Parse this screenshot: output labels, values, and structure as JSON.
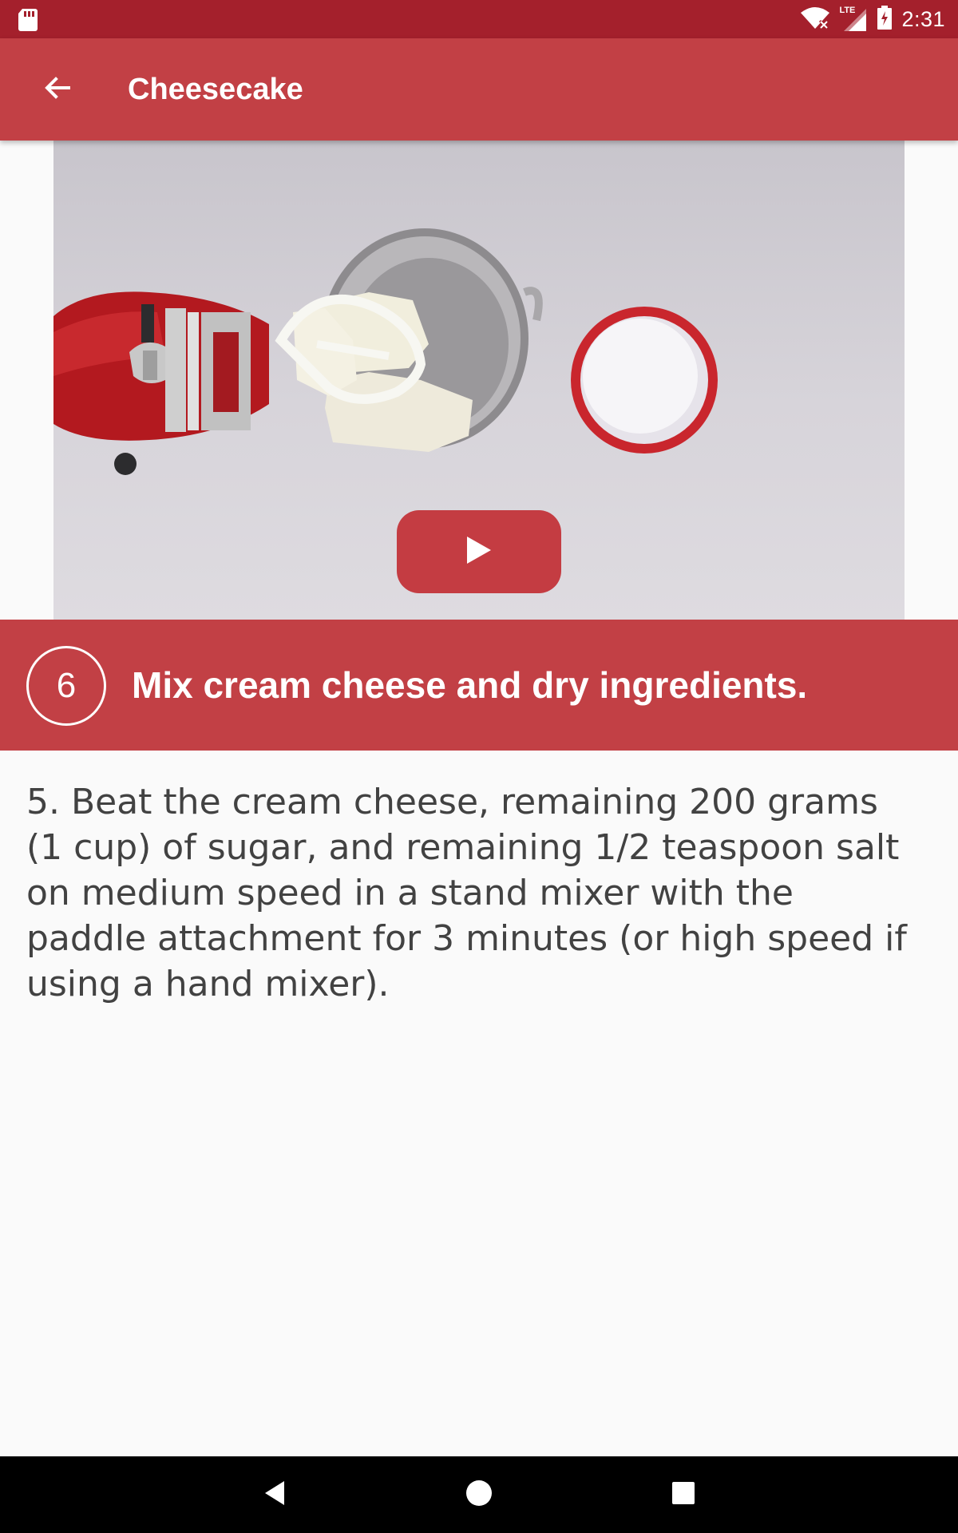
{
  "status_bar": {
    "time": "2:31",
    "network": "LTE",
    "icons": [
      "sd-card-icon",
      "wifi-icon",
      "signal-icon",
      "battery-charging-icon"
    ]
  },
  "app_bar": {
    "title": "Cheesecake",
    "back_icon": "arrow-left-icon"
  },
  "video": {
    "play_icon": "play-icon"
  },
  "step": {
    "number": "6",
    "title": "Mix cream cheese and dry ingredients."
  },
  "instructions": {
    "text": "5. Beat the cream cheese, remaining 200 grams (1 cup) of sugar, and remaining 1/2 teaspoon salt on medium speed in a stand mixer with the paddle attachment for 3 minutes (or high speed if using a hand mixer)."
  },
  "nav_bar": {
    "icons": [
      "back-triangle-icon",
      "home-circle-icon",
      "recents-square-icon"
    ]
  },
  "colors": {
    "status_bar": "#a4202c",
    "primary": "#c24045",
    "background": "#fafafa",
    "text": "#424242"
  }
}
